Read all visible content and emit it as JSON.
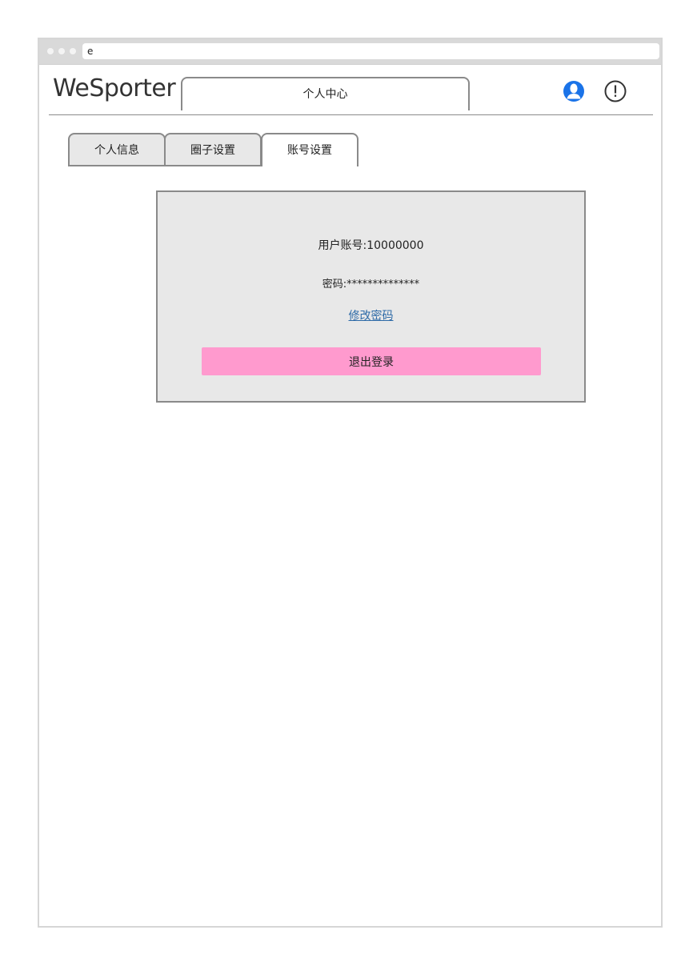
{
  "browser": {
    "address_text": "e"
  },
  "header": {
    "logo": "WeSporter",
    "center_tab": "个人中心",
    "icons": {
      "user": "user-icon",
      "alert": "alert-icon"
    }
  },
  "tabs": [
    {
      "label": "个人信息",
      "active": false
    },
    {
      "label": "圈子设置",
      "active": false
    },
    {
      "label": "账号设置",
      "active": true
    }
  ],
  "account": {
    "account_text": "用户账号:10000000",
    "password_text": "密码:**************",
    "change_password_link": "修改密码",
    "logout_button": "退出登录"
  },
  "colors": {
    "accent_blue": "#1a73e8",
    "logout_pink": "#ff9ace",
    "panel_bg": "#e8e8e8",
    "link": "#2d6aa7"
  }
}
